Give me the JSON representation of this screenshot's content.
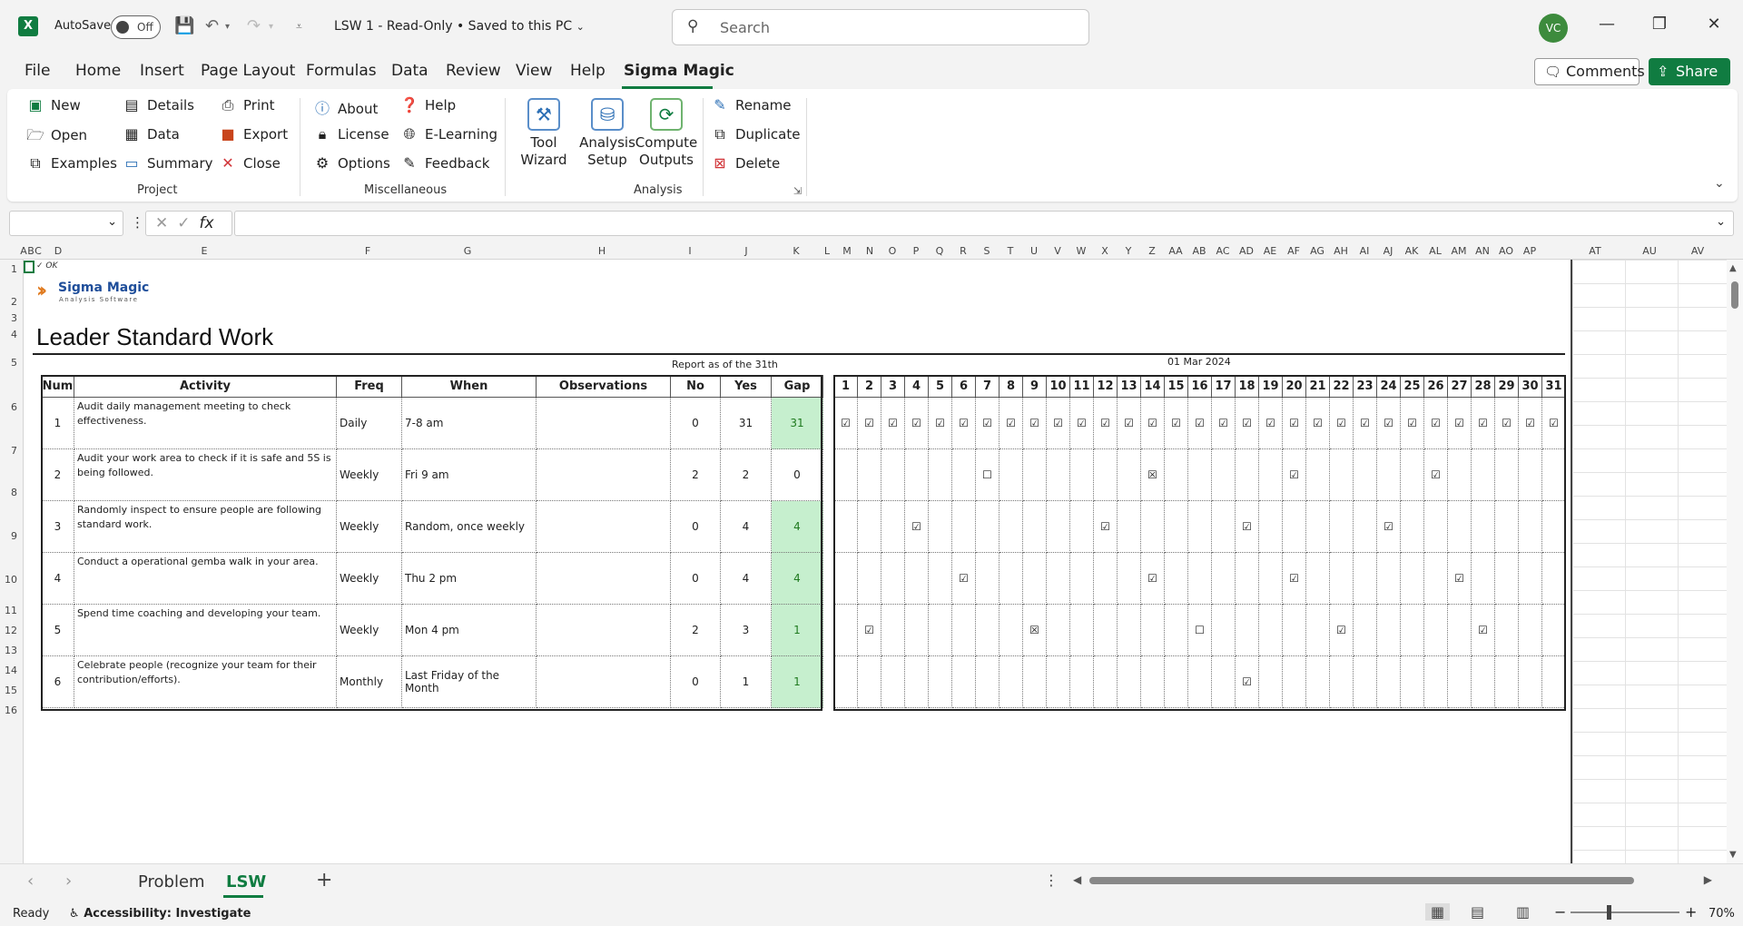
{
  "titlebar": {
    "app_logo": "X",
    "autosave_label": "AutoSave",
    "autosave_state": "Off",
    "doc_title": "LSW 1  -  Read-Only  •  Saved to this PC",
    "search_placeholder": "Search",
    "avatar_initials": "VC",
    "icons": [
      "save-icon",
      "undo-icon",
      "redo-icon",
      "customize-icon",
      "minimize-icon",
      "restore-icon",
      "close-icon"
    ]
  },
  "menu": {
    "tabs": [
      "File",
      "Home",
      "Insert",
      "Page Layout",
      "Formulas",
      "Data",
      "Review",
      "View",
      "Help",
      "Sigma Magic"
    ],
    "active": "Sigma Magic",
    "comments": "Comments",
    "share": "Share"
  },
  "ribbon": {
    "project": {
      "label": "Project",
      "items": [
        "New",
        "Open",
        "Examples",
        "Details",
        "Data",
        "Summary",
        "Print",
        "Export",
        "Close"
      ]
    },
    "misc": {
      "label": "Miscellaneous",
      "items": [
        "About",
        "License",
        "Options",
        "Help",
        "E-Learning",
        "Feedback"
      ]
    },
    "analysis": {
      "label": "Analysis",
      "big": [
        "Tool\nWizard",
        "Analysis\nSetup",
        "Compute\nOutputs"
      ],
      "items": [
        "Rename",
        "Duplicate",
        "Delete"
      ]
    }
  },
  "formula": {
    "fx": "fx"
  },
  "grid": {
    "column_headers": [
      "A",
      "B",
      "C",
      "D",
      "E",
      "F",
      "G",
      "H",
      "I",
      "J",
      "K",
      "L",
      "M",
      "N",
      "O",
      "P",
      "Q",
      "R",
      "S",
      "T",
      "U",
      "V",
      "W",
      "X",
      "Y",
      "Z",
      "AA",
      "AB",
      "AC",
      "AD",
      "AE",
      "AF",
      "AG",
      "AH",
      "AI",
      "AJ",
      "AK",
      "AL",
      "AM",
      "AN",
      "AO",
      "AP",
      "AT",
      "AU",
      "AV"
    ],
    "row_headers": [
      "1",
      "2",
      "3",
      "4",
      "5",
      "6",
      "7",
      "8",
      "9",
      "10",
      "11",
      "12",
      "13",
      "14",
      "15",
      "16"
    ],
    "ok_text": "✓ OK"
  },
  "sheet": {
    "logo_title": "Sigma Magic",
    "logo_sub": "Analysis Software",
    "title": "Leader Standard Work",
    "report_label": "Report as of the 31th",
    "date_label": "01 Mar 2024",
    "headers": [
      "Num",
      "Activity",
      "Freq",
      "When",
      "Observations",
      "No",
      "Yes",
      "Gap"
    ],
    "rows": [
      {
        "num": "1",
        "activity": "Audit daily management meeting to check effectiveness.",
        "freq": "Daily",
        "when": "7-8 am",
        "obs": "",
        "no": "0",
        "yes": "31",
        "gap": "31",
        "gap_green": true
      },
      {
        "num": "2",
        "activity": "Audit your work area to check if it is safe and 5S is being followed.",
        "freq": "Weekly",
        "when": "Fri 9 am",
        "obs": "",
        "no": "2",
        "yes": "2",
        "gap": "0",
        "gap_green": false
      },
      {
        "num": "3",
        "activity": "Randomly inspect to ensure people are following standard work.",
        "freq": "Weekly",
        "when": "Random, once weekly",
        "obs": "",
        "no": "0",
        "yes": "4",
        "gap": "4",
        "gap_green": true
      },
      {
        "num": "4",
        "activity": "Conduct a operational gemba walk in your area.",
        "freq": "Weekly",
        "when": "Thu 2 pm",
        "obs": "",
        "no": "0",
        "yes": "4",
        "gap": "4",
        "gap_green": true
      },
      {
        "num": "5",
        "activity": "Spend time coaching and developing your team.",
        "freq": "Weekly",
        "when": "Mon 4 pm",
        "obs": "",
        "no": "2",
        "yes": "3",
        "gap": "1",
        "gap_green": true
      },
      {
        "num": "6",
        "activity": "Celebrate people (recognize your team for their contribution/efforts).",
        "freq": "Monthly",
        "when": " Last Friday of the Month",
        "obs": "",
        "no": "0",
        "yes": "1",
        "gap": "1",
        "gap_green": true
      }
    ],
    "days": [
      "1",
      "2",
      "3",
      "4",
      "5",
      "6",
      "7",
      "8",
      "9",
      "10",
      "11",
      "12",
      "13",
      "14",
      "15",
      "16",
      "17",
      "18",
      "19",
      "20",
      "21",
      "22",
      "23",
      "24",
      "25",
      "26",
      "27",
      "28",
      "29",
      "30",
      "31"
    ],
    "marks": {
      "row1": {
        "1": "☑",
        "2": "☑",
        "3": "☑",
        "4": "☑",
        "5": "☑",
        "6": "☑",
        "7": "☑",
        "8": "☑",
        "9": "☑",
        "10": "☑",
        "11": "☑",
        "12": "☑",
        "13": "☑",
        "14": "☑",
        "15": "☑",
        "16": "☑",
        "17": "☑",
        "18": "☑",
        "19": "☑",
        "20": "☑",
        "21": "☑",
        "22": "☑",
        "23": "☑",
        "24": "☑",
        "25": "☑",
        "26": "☑",
        "27": "☑",
        "28": "☑",
        "29": "☑",
        "30": "☑",
        "31": "☑"
      },
      "row2": {
        "7": "☐",
        "14": "☒",
        "20": "☑",
        "26": "☑"
      },
      "row3": {
        "4": "☑",
        "12": "☑",
        "18": "☑",
        "24": "☑"
      },
      "row4": {
        "6": "☑",
        "14": "☑",
        "20": "☑",
        "27": "☑"
      },
      "row5": {
        "2": "☑",
        "9": "☒",
        "16": "☐",
        "22": "☑",
        "28": "☑"
      },
      "row6": {
        "18": "☑"
      }
    }
  },
  "tabs": {
    "sheets": [
      "Problem",
      "LSW"
    ],
    "active": "LSW",
    "add": "+"
  },
  "status": {
    "ready": "Ready",
    "accessibility": "Accessibility: Investigate",
    "zoom": "70%"
  }
}
